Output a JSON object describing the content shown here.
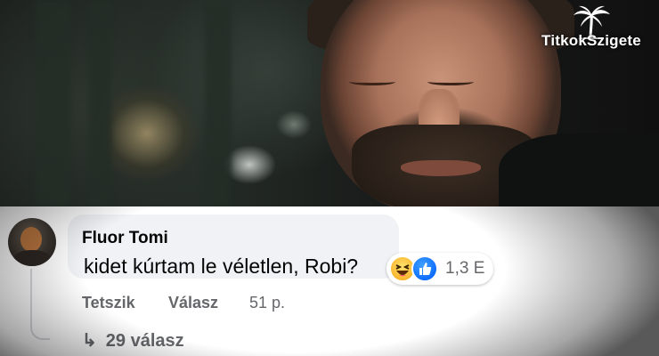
{
  "logo": {
    "text_left": "Titkok",
    "text_right": "Szigete"
  },
  "comment": {
    "author": "Fluor Tomi",
    "text": "kidet kúrtam le véletlen, Robi?",
    "reactions": {
      "count": "1,3 E",
      "types": [
        "haha-icon",
        "like-icon"
      ]
    },
    "actions": {
      "like_label": "Tetszik",
      "reply_label": "Válasz",
      "time": "51 p."
    },
    "replies": {
      "arrow": "↳",
      "label": "29 válasz"
    }
  },
  "colors": {
    "bubble": "#f0f2f5",
    "meta_text": "#65676b",
    "primary_text": "#050505",
    "like_blue": "#0866ff",
    "haha_yellow": "#f7b125"
  }
}
